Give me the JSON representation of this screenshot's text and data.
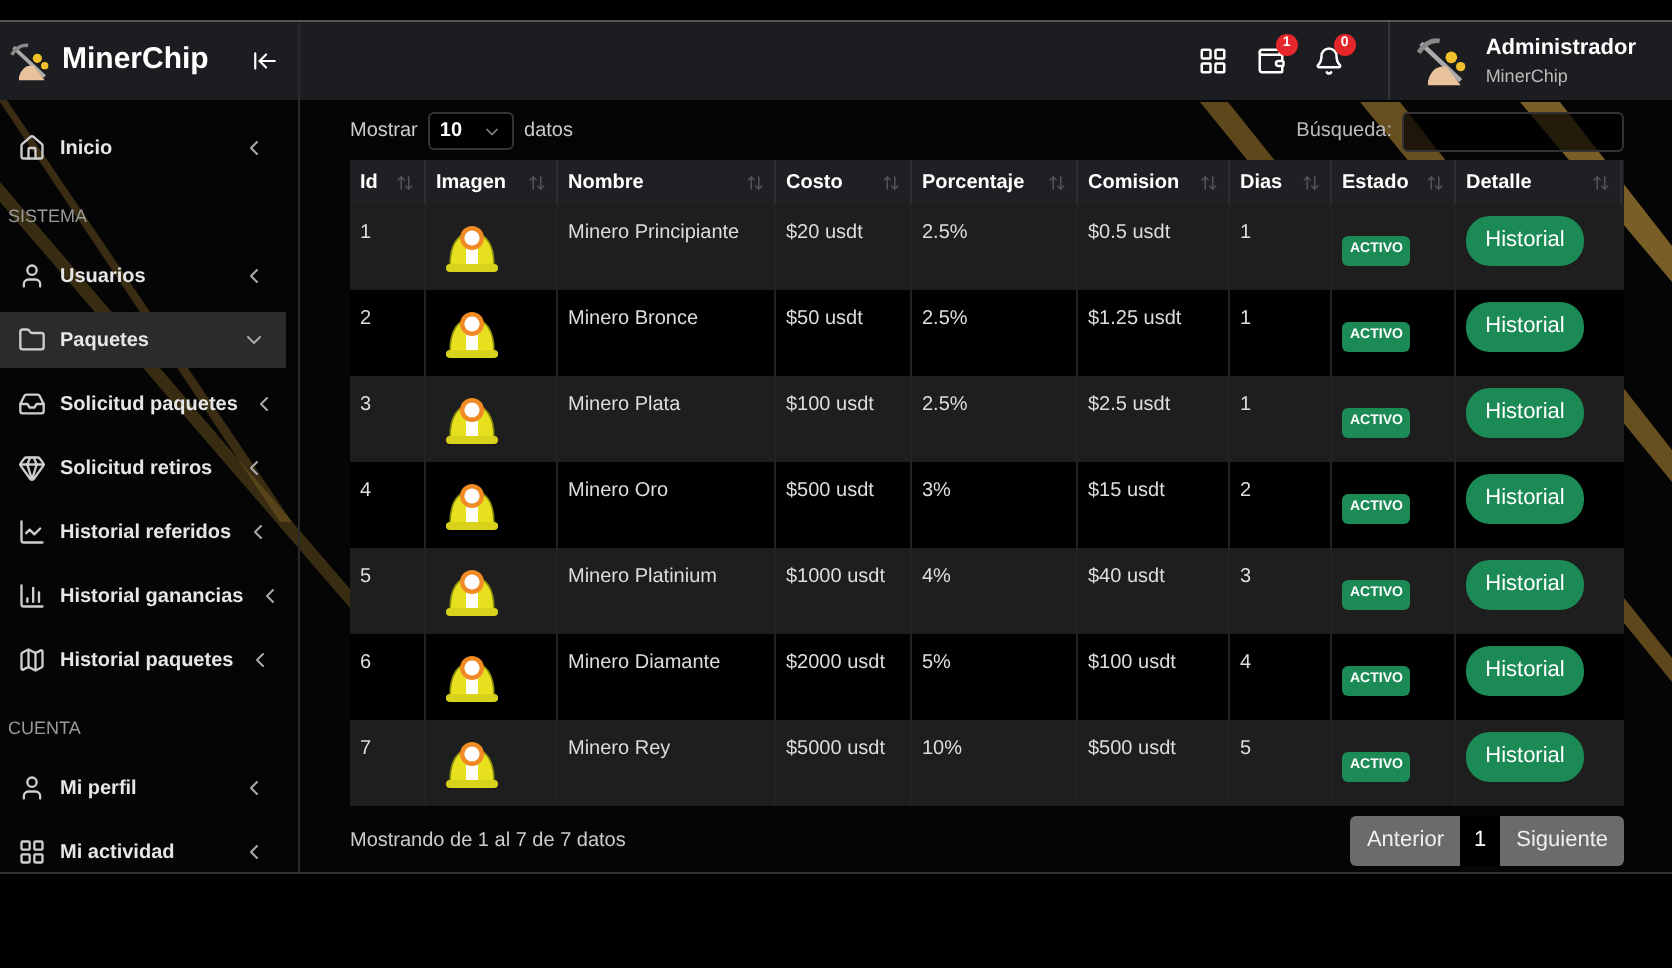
{
  "brand": {
    "name": "MinerChip"
  },
  "header": {
    "badges": [
      {
        "kind": "apps"
      },
      {
        "kind": "wallet",
        "count": "1"
      },
      {
        "kind": "bell",
        "count": "0"
      }
    ],
    "user": {
      "name": "Administrador",
      "subtitle": "MinerChip"
    }
  },
  "sidebar": {
    "items": [
      {
        "kind": "item",
        "label": "Inicio",
        "selected": false,
        "expanded": false
      },
      {
        "kind": "section",
        "label": "SISTEMA"
      },
      {
        "kind": "item",
        "label": "Usuarios",
        "selected": false,
        "expanded": false
      },
      {
        "kind": "item",
        "label": "Paquetes",
        "selected": true,
        "expanded": true
      },
      {
        "kind": "item",
        "label": "Solicitud paquetes",
        "selected": false,
        "expanded": false
      },
      {
        "kind": "item",
        "label": "Solicitud retiros",
        "selected": false,
        "expanded": false
      },
      {
        "kind": "item",
        "label": "Historial referidos",
        "selected": false,
        "expanded": false
      },
      {
        "kind": "item",
        "label": "Historial ganancias",
        "selected": false,
        "expanded": false
      },
      {
        "kind": "item",
        "label": "Historial paquetes",
        "selected": false,
        "expanded": false
      },
      {
        "kind": "section",
        "label": "CUENTA"
      },
      {
        "kind": "item",
        "label": "Mi perfil",
        "selected": false,
        "expanded": false
      },
      {
        "kind": "item",
        "label": "Mi actividad",
        "selected": false,
        "expanded": false
      }
    ]
  },
  "toolbar": {
    "show_label": "Mostrar",
    "page_size": "10",
    "after_label": "datos",
    "search_label": "Búsqueda:"
  },
  "table": {
    "columns": [
      "Id",
      "Imagen",
      "Nombre",
      "Costo",
      "Porcentaje",
      "Comision",
      "Dias",
      "Estado",
      "Detalle"
    ],
    "rows": [
      {
        "id": "1",
        "name": "Minero Principiante",
        "cost": "$20 usdt",
        "percent": "2.5%",
        "commission": "$0.5 usdt",
        "days": "1",
        "status": "ACTIVO",
        "action": "Historial"
      },
      {
        "id": "2",
        "name": "Minero Bronce",
        "cost": "$50 usdt",
        "percent": "2.5%",
        "commission": "$1.25 usdt",
        "days": "1",
        "status": "ACTIVO",
        "action": "Historial"
      },
      {
        "id": "3",
        "name": "Minero Plata",
        "cost": "$100 usdt",
        "percent": "2.5%",
        "commission": "$2.5 usdt",
        "days": "1",
        "status": "ACTIVO",
        "action": "Historial"
      },
      {
        "id": "4",
        "name": "Minero Oro",
        "cost": "$500 usdt",
        "percent": "3%",
        "commission": "$15 usdt",
        "days": "2",
        "status": "ACTIVO",
        "action": "Historial"
      },
      {
        "id": "5",
        "name": "Minero Platinium",
        "cost": "$1000 usdt",
        "percent": "4%",
        "commission": "$40 usdt",
        "days": "3",
        "status": "ACTIVO",
        "action": "Historial"
      },
      {
        "id": "6",
        "name": "Minero Diamante",
        "cost": "$2000 usdt",
        "percent": "5%",
        "commission": "$100 usdt",
        "days": "4",
        "status": "ACTIVO",
        "action": "Historial"
      },
      {
        "id": "7",
        "name": "Minero Rey",
        "cost": "$5000 usdt",
        "percent": "10%",
        "commission": "$500 usdt",
        "days": "5",
        "status": "ACTIVO",
        "action": "Historial"
      }
    ]
  },
  "footer": {
    "info": "Mostrando de 1 al 7 de 7 datos",
    "pagination": [
      {
        "label": "Anterior",
        "selected": false
      },
      {
        "label": "1",
        "selected": true
      },
      {
        "label": "Siguiente",
        "selected": false
      }
    ]
  }
}
